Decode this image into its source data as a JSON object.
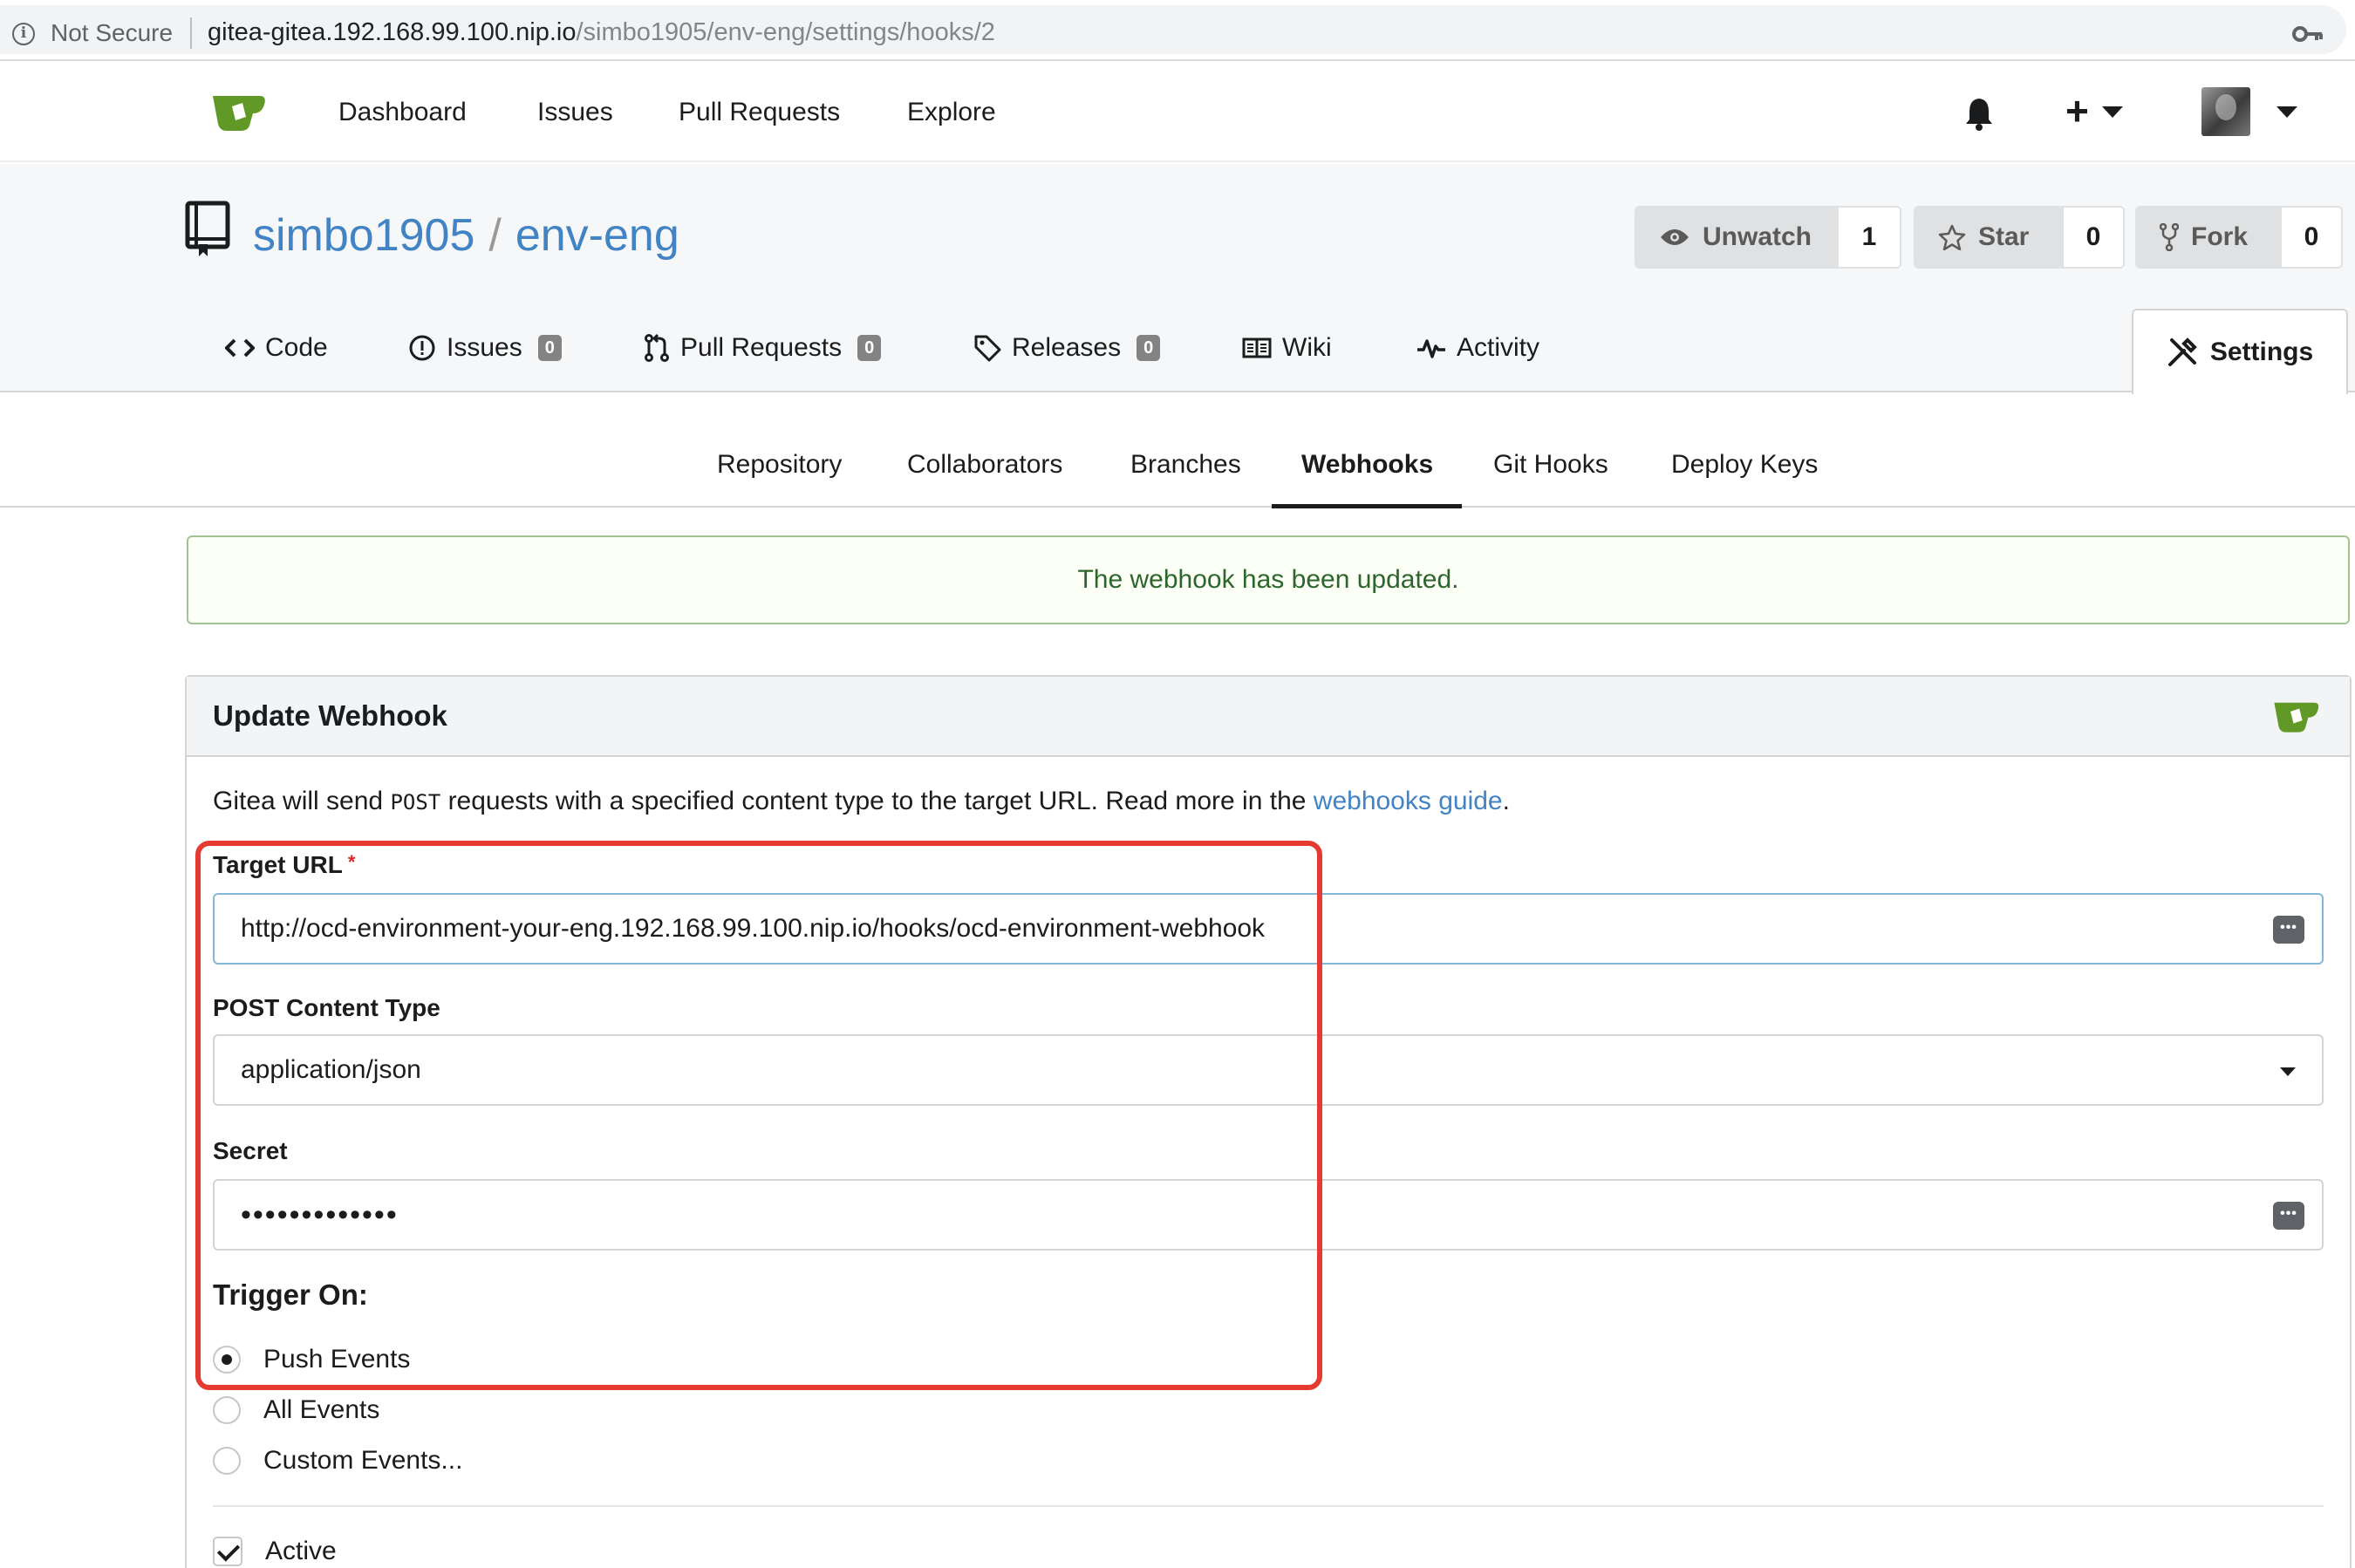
{
  "browser": {
    "security_label": "Not Secure",
    "url_host": "gitea-gitea.192.168.99.100.nip.io",
    "url_path": "/simbo1905/env-eng/settings/hooks/2"
  },
  "topnav": {
    "items": [
      {
        "label": "Dashboard"
      },
      {
        "label": "Issues"
      },
      {
        "label": "Pull Requests"
      },
      {
        "label": "Explore"
      }
    ],
    "plus_label": "+"
  },
  "repo": {
    "owner": "simbo1905",
    "separator": "/",
    "name": "env-eng",
    "unwatch_label": "Unwatch",
    "watch_count": "1",
    "star_label": "Star",
    "star_count": "0",
    "fork_label": "Fork",
    "fork_count": "0"
  },
  "repo_tabs": {
    "code": "Code",
    "issues": "Issues",
    "issues_count": "0",
    "pulls": "Pull Requests",
    "pulls_count": "0",
    "releases": "Releases",
    "releases_count": "0",
    "wiki": "Wiki",
    "activity": "Activity",
    "settings": "Settings"
  },
  "settings_menu": {
    "repository": "Repository",
    "collaborators": "Collaborators",
    "branches": "Branches",
    "webhooks": "Webhooks",
    "git_hooks": "Git Hooks",
    "deploy_keys": "Deploy Keys"
  },
  "flash": {
    "message": "The webhook has been updated."
  },
  "webhook": {
    "title": "Update Webhook",
    "desc_before": "Gitea will send ",
    "desc_code": "POST",
    "desc_middle": " requests with a specified content type to the target URL. Read more in the ",
    "desc_link": "webhooks guide",
    "desc_after": ".",
    "target_url_label": "Target URL",
    "required_mark": "*",
    "target_url_value": "http://ocd-environment-your-eng.192.168.99.100.nip.io/hooks/ocd-environment-webhook",
    "content_type_label": "POST Content Type",
    "content_type_value": "application/json",
    "secret_label": "Secret",
    "secret_mask": "•••••••••••••",
    "trigger_label": "Trigger On:",
    "triggers": [
      {
        "label": "Push Events",
        "selected": true
      },
      {
        "label": "All Events",
        "selected": false
      },
      {
        "label": "Custom Events...",
        "selected": false
      }
    ],
    "active_label": "Active",
    "active_checked": true
  },
  "colors": {
    "link": "#4183c4",
    "success_text": "#2c662d",
    "success_border": "#a3c293",
    "annotation": "#e53a2f",
    "gitea_green": "#609926"
  }
}
